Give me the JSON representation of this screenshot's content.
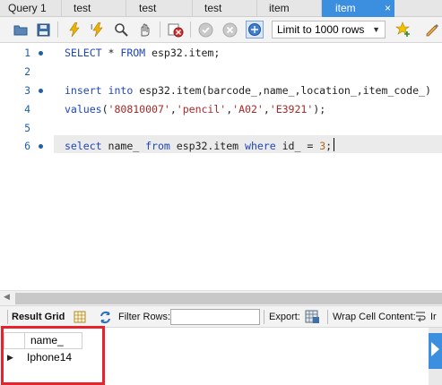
{
  "tabs": [
    {
      "label": "Query 1",
      "active": false
    },
    {
      "label": "test",
      "active": false
    },
    {
      "label": "test",
      "active": false
    },
    {
      "label": "test",
      "active": false
    },
    {
      "label": "item",
      "active": false
    },
    {
      "label": "item",
      "active": true
    }
  ],
  "tab_close_glyph": "×",
  "toolbar": {
    "icons": [
      "open-folder-icon",
      "save-icon",
      "execute-icon",
      "execute-current-icon",
      "explain-icon",
      "stop-icon",
      "toggle-error-icon",
      "commit-icon",
      "rollback-icon",
      "autocommit-icon"
    ],
    "limit_select": "Limit to 1000 rows",
    "after_icons": [
      "beautify-icon",
      "find-icon"
    ]
  },
  "editor": {
    "lines": [
      {
        "number": "1",
        "dot": true
      },
      {
        "number": "2",
        "dot": false
      },
      {
        "number": "3",
        "dot": true
      },
      {
        "number": "4",
        "dot": false
      },
      {
        "number": "5",
        "dot": false
      },
      {
        "number": "6",
        "dot": true
      }
    ],
    "line1": {
      "k1": "SELECT",
      "t1": " * ",
      "k2": "FROM",
      "t2": " esp32.item;"
    },
    "line3": {
      "k1": "insert",
      "t1": " ",
      "k2": "into",
      "t2": " esp32.item(barcode_,name_,location_,item_code_)"
    },
    "line4": {
      "k1": "values",
      "t1": "(",
      "s1": "'80810007'",
      "c1": ",",
      "s2": "'pencil'",
      "c2": ",",
      "s3": "'A02'",
      "c3": ",",
      "s4": "'E3921'",
      "t2": ");"
    },
    "line6": {
      "k1": "select",
      "t1": " name_ ",
      "k2": "from",
      "t2": " esp32.item ",
      "k3": "where",
      "t3": " id_ = ",
      "n1": "3",
      "t4": ";"
    }
  },
  "result_toolbar": {
    "result_grid": "Result Grid",
    "filter_rows": "Filter Rows:",
    "filter_value": "",
    "export": "Export:",
    "wrap": "Wrap Cell Content:",
    "truncated": "Ir"
  },
  "grid": {
    "columns": [
      "name_"
    ],
    "rows": [
      [
        "Iphone14"
      ]
    ],
    "row_pointer": "▶"
  },
  "colors": {
    "accent": "#3c8ede",
    "highlight_box": "#e8232d"
  }
}
